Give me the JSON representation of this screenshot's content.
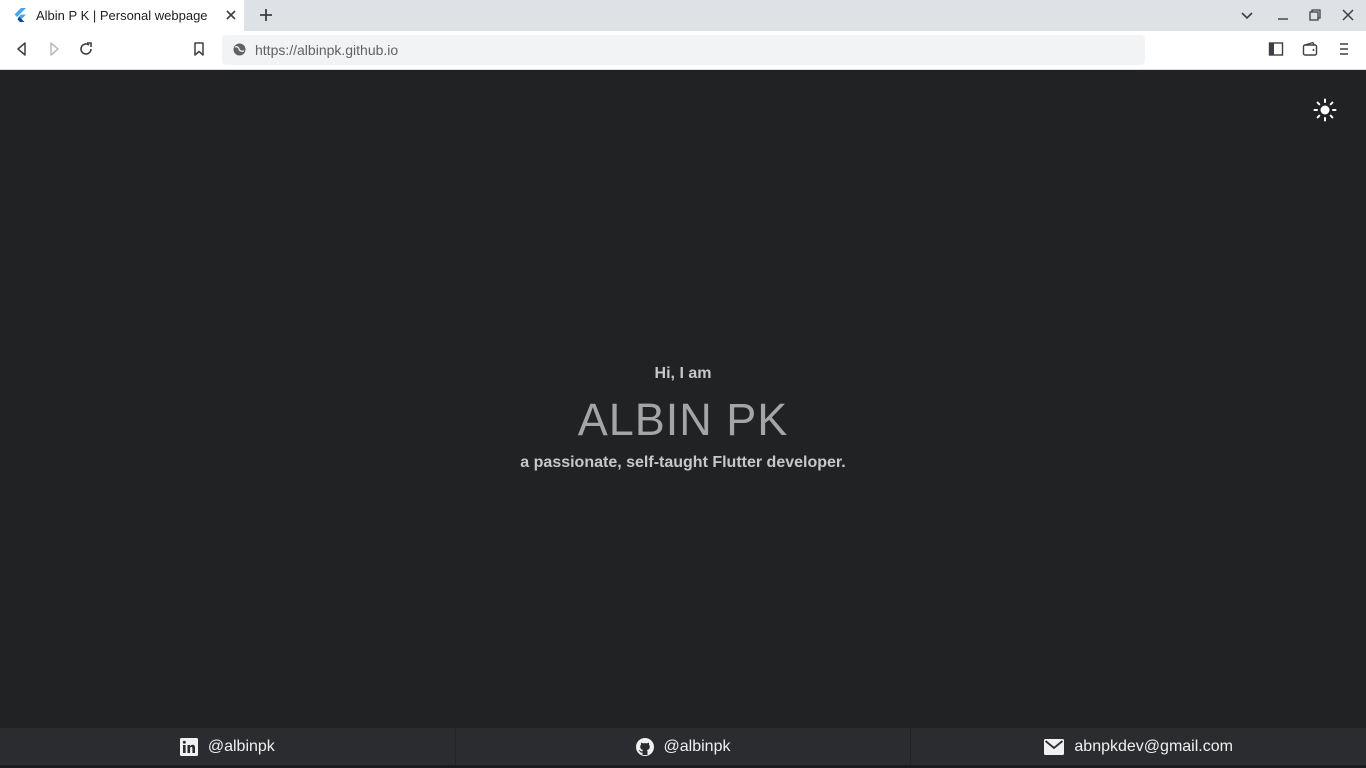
{
  "browser": {
    "tab_title": "Albin P K | Personal webpage",
    "url": "https://albinpk.github.io"
  },
  "hero": {
    "greeting": "Hi, I am",
    "name": "ALBIN PK",
    "tagline": "a passionate, self-taught Flutter developer."
  },
  "footer": {
    "linkedin": "@albinpk",
    "github": "@albinpk",
    "email": "abnpkdev@gmail.com"
  },
  "icons": {
    "tab_favicon": "flutter-icon",
    "theme_toggle": "sun-icon",
    "linkedin": "linkedin-icon",
    "github": "github-icon",
    "email": "mail-icon"
  },
  "colors": {
    "page_background": "#212224",
    "footer_background": "#2b2c30",
    "name_text": "#a4a5a7",
    "secondary_text": "#c6c7c9"
  }
}
